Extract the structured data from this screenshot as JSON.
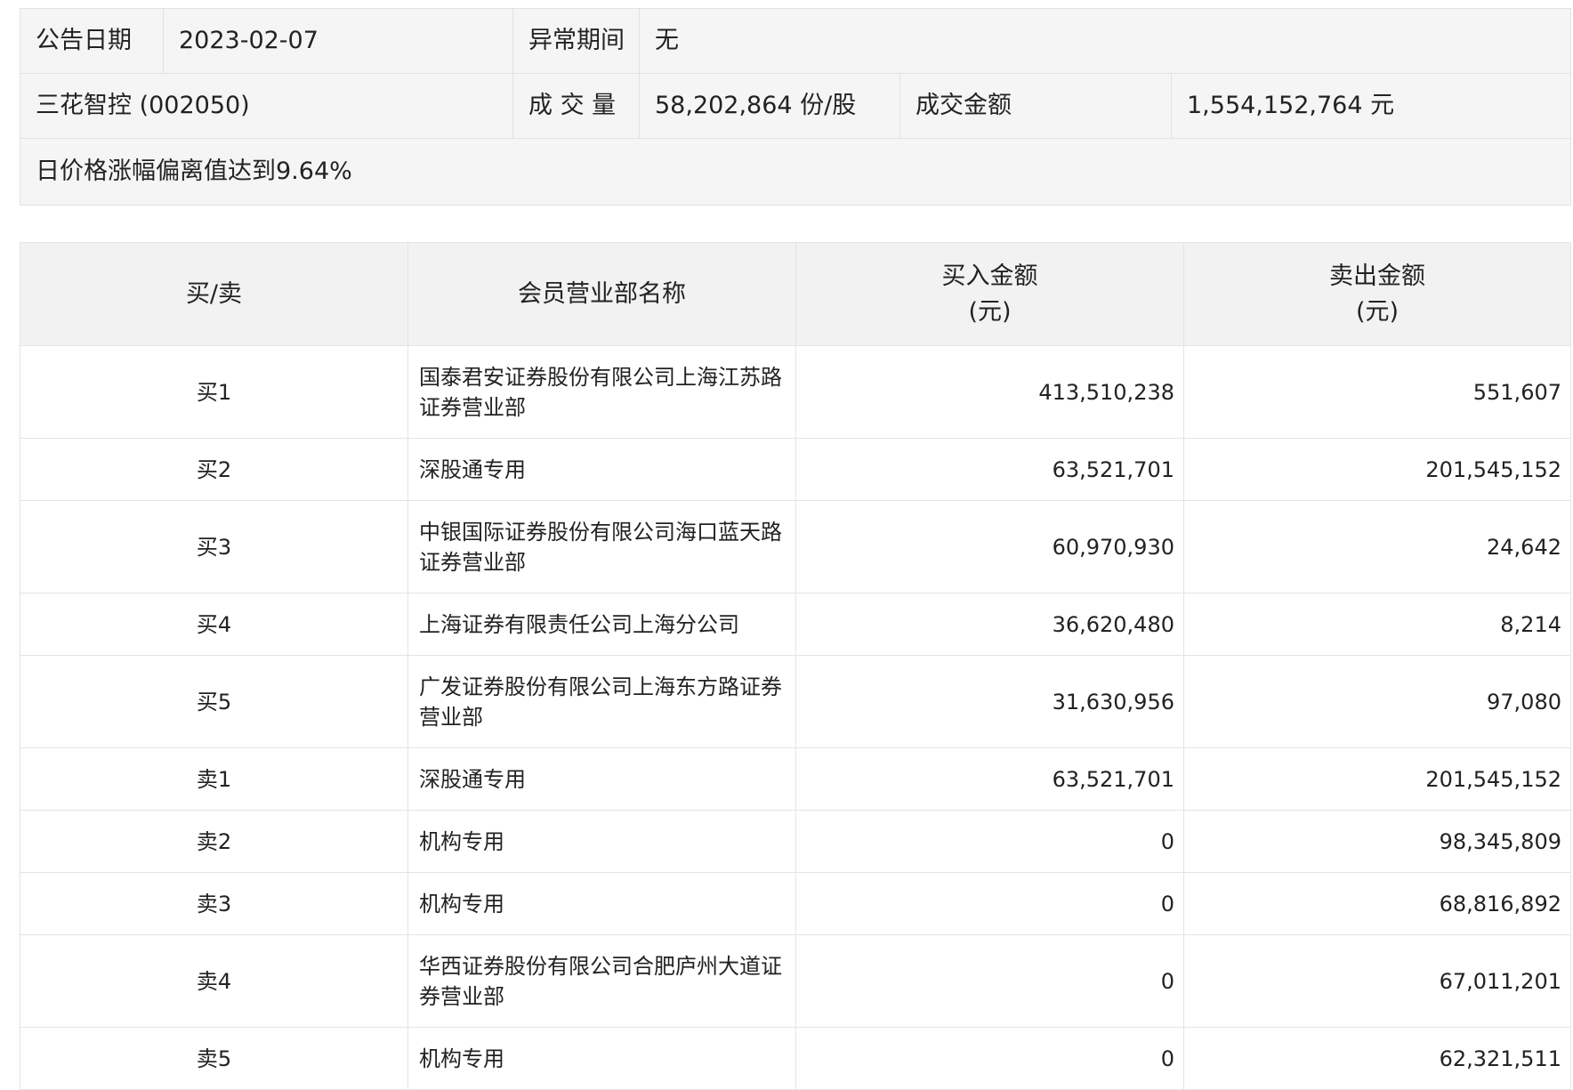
{
  "info": {
    "date_label": "公告日期",
    "date_value": "2023-02-07",
    "period_label": "异常期间",
    "period_value": "无",
    "stock": "三花智控 (002050)",
    "volume_label": "成 交 量",
    "volume_value": "58,202,864 份/股",
    "amount_label": "成交金额",
    "amount_value": "1,554,152,764 元",
    "reason": "日价格涨幅偏离值达到9.64%"
  },
  "table": {
    "headers": {
      "side": "买/卖",
      "name": "会员营业部名称",
      "buy_line1": "买入金额",
      "buy_line2": "(元)",
      "sell_line1": "卖出金额",
      "sell_line2": "(元)"
    },
    "rows": [
      {
        "side": "买1",
        "name": "国泰君安证券股份有限公司上海江苏路证券营业部",
        "buy": "413,510,238",
        "sell": "551,607"
      },
      {
        "side": "买2",
        "name": "深股通专用",
        "buy": "63,521,701",
        "sell": "201,545,152"
      },
      {
        "side": "买3",
        "name": "中银国际证券股份有限公司海口蓝天路证券营业部",
        "buy": "60,970,930",
        "sell": "24,642"
      },
      {
        "side": "买4",
        "name": "上海证券有限责任公司上海分公司",
        "buy": "36,620,480",
        "sell": "8,214"
      },
      {
        "side": "买5",
        "name": "广发证券股份有限公司上海东方路证券营业部",
        "buy": "31,630,956",
        "sell": "97,080"
      },
      {
        "side": "卖1",
        "name": "深股通专用",
        "buy": "63,521,701",
        "sell": "201,545,152"
      },
      {
        "side": "卖2",
        "name": "机构专用",
        "buy": "0",
        "sell": "98,345,809"
      },
      {
        "side": "卖3",
        "name": "机构专用",
        "buy": "0",
        "sell": "68,816,892"
      },
      {
        "side": "卖4",
        "name": "华西证券股份有限公司合肥庐州大道证券营业部",
        "buy": "0",
        "sell": "67,011,201"
      },
      {
        "side": "卖5",
        "name": "机构专用",
        "buy": "0",
        "sell": "62,321,511"
      }
    ]
  }
}
